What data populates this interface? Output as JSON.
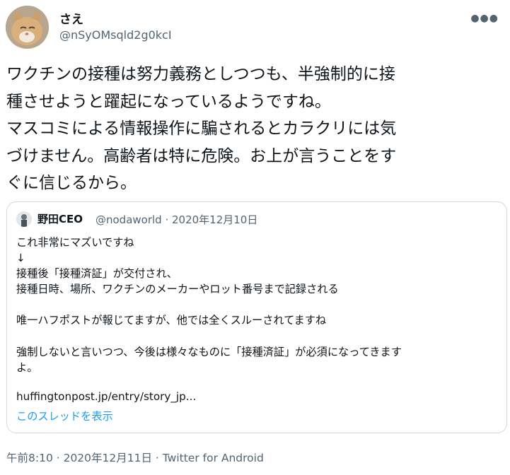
{
  "author": {
    "display_name": "さえ",
    "handle": "@nSyOMsqld2g0kcI"
  },
  "tweet": {
    "text": "ワクチンの接種は努力義務としつつも、半強制的に接\n種させようと躍起になっているようですね。\nマスコミによる情報操作に騙されるとカラクリには気\nづけません。高齢者は特に危険。お上が言うことをす\nぐに信じるから。"
  },
  "quote": {
    "display_name": "野田CEO",
    "handle_line": "@nodaworld · 2020年12月10日",
    "body": "これ非常にマズいですね\n↓\n接種後「接種済証」が交付され、\n接種日時、場所、ワクチンのメーカーやロット番号まで記録される\n\n唯一ハフポストが報じてますが、他では全くスルーされてますね\n\n強制しないと言いつつ、今後は様々なものに「接種済証」が必須になってきます\nよ。",
    "link": "huffingtonpost.jp/entry/story_jp...",
    "show_thread": "このスレッドを表示"
  },
  "footer": {
    "meta": "午前8:10 · 2020年12月11日 · Twitter for Android"
  },
  "icons": {
    "more": "more-options-icon",
    "avatar": "cat-avatar-image",
    "quote_avatar": "quote-avatar-image"
  },
  "colors": {
    "text": "#0f1419",
    "secondary": "#536471",
    "link": "#1d9bf0",
    "border": "#cfd9de"
  }
}
